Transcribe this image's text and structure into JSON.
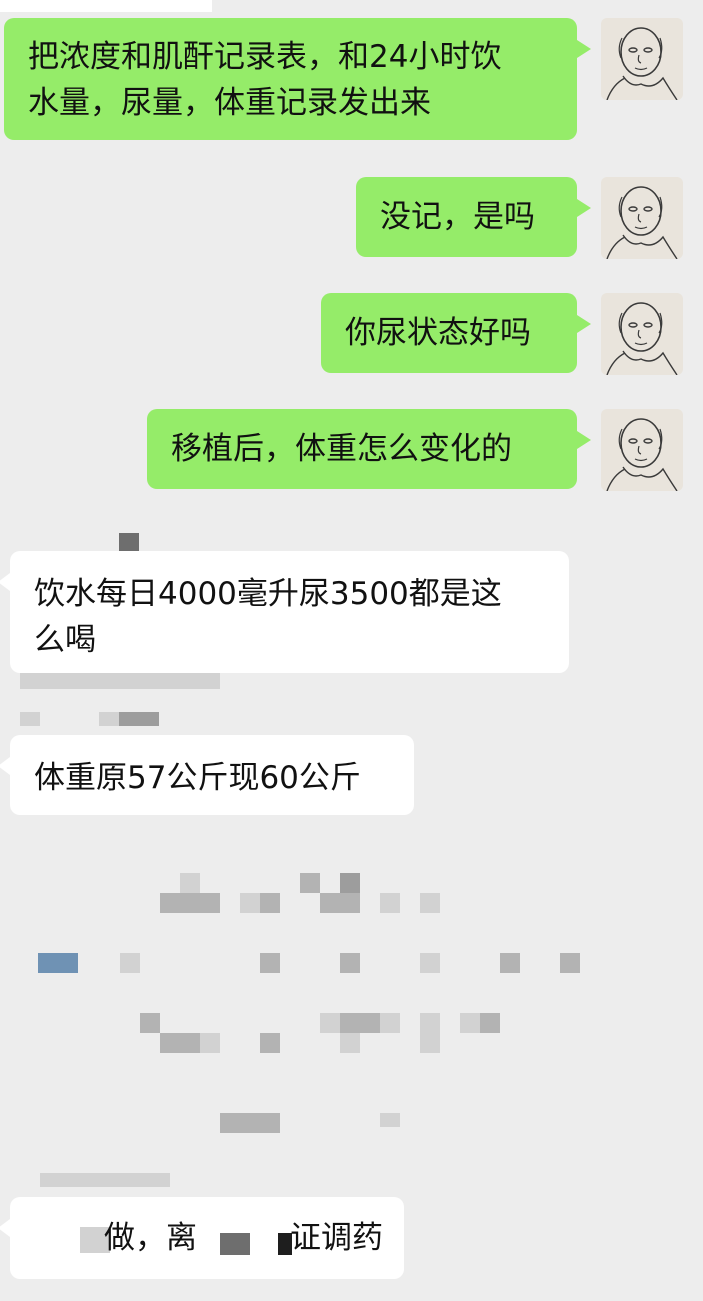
{
  "chat": {
    "messages": [
      {
        "side": "out",
        "text": "把浓度和肌酐记录表，和24小时饮\n水量，尿量，体重记录发出来"
      },
      {
        "side": "out",
        "text": "没记，是吗"
      },
      {
        "side": "out",
        "text": "你尿状态好吗"
      },
      {
        "side": "out",
        "text": "移植后，体重怎么变化的"
      },
      {
        "side": "in",
        "text": "饮水每日4000毫升尿3500都是这\n么喝"
      },
      {
        "side": "in",
        "text": "体重原57公斤现60公斤"
      },
      {
        "side": "in",
        "text": "做，离",
        "text_end": "证调药"
      }
    ],
    "avatar_icon": "sketched-face-avatar",
    "colors": {
      "background": "#ededed",
      "outgoing_bubble": "#95ec69",
      "incoming_bubble": "#ffffff"
    }
  }
}
